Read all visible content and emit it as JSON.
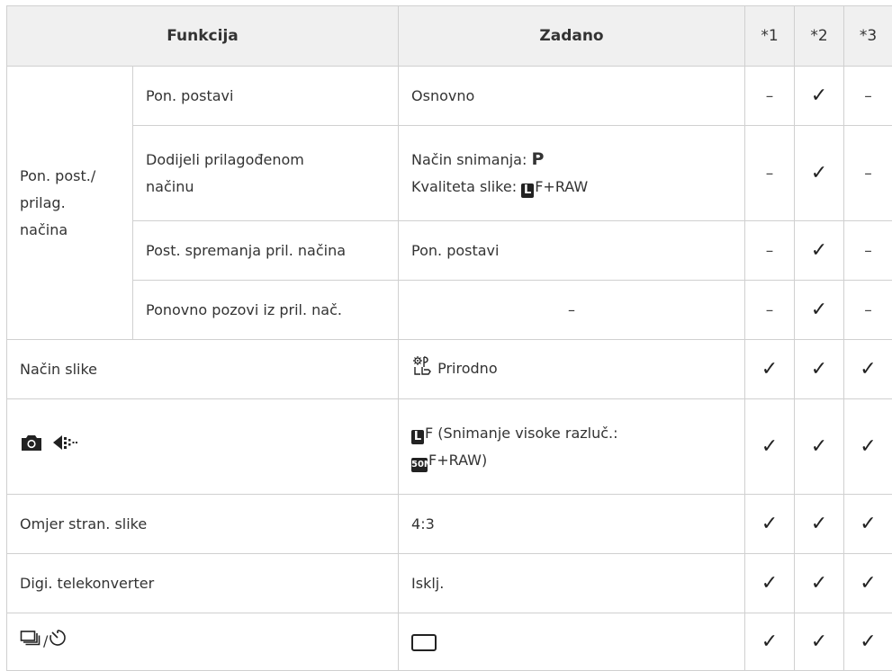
{
  "headers": {
    "funkcija": "Funkcija",
    "zadano": "Zadano",
    "c1": "*1",
    "c2": "*2",
    "c3": "*3"
  },
  "marks": {
    "dash": "–",
    "check": "✓"
  },
  "group": {
    "label_l1": "Pon. post./",
    "label_l2": "prilag.",
    "label_l3": "načina"
  },
  "rows": {
    "pon_postavi": {
      "name": "Pon. postavi",
      "value": "Osnovno"
    },
    "dodijeli": {
      "name_l1": "Dodijeli prilagođenom",
      "name_l2": "načinu",
      "value_l1_prefix": "Način snimanja: ",
      "value_l1_bold": "P",
      "value_l2_prefix": "Kvaliteta slike: ",
      "value_l2_badge": "L",
      "value_l2_suffix": "F+RAW"
    },
    "post_spremanja": {
      "name": "Post. spremanja pril. načina",
      "value": "Pon. postavi"
    },
    "ponovno_pozovi": {
      "name": "Ponovno pozovi iz pril. nač.",
      "value": "–"
    },
    "nacin_slike": {
      "name": "Način slike",
      "value": "Prirodno"
    },
    "camera_quality": {
      "name_icons": [
        "camera-icon",
        "image-quality-icon"
      ],
      "value_badge": "L",
      "value_l1": "F (Snimanje visoke razluč.:",
      "value_badge2": "50M",
      "value_l2": "F+RAW)"
    },
    "omjer": {
      "name": "Omjer stran. slike",
      "value": "4:3"
    },
    "digi": {
      "name": "Digi. telekonverter",
      "value": "Isklj."
    },
    "drive": {
      "name_icons": [
        "sequential-shooting-icon",
        "self-timer-icon"
      ],
      "name_sep": "/",
      "value_icon": "single-frame-icon"
    }
  }
}
